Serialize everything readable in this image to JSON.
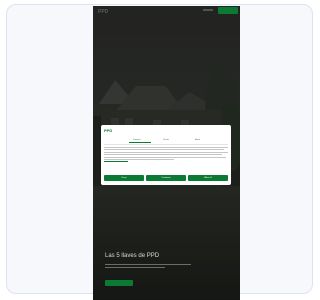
{
  "header": {
    "logo": "PPD",
    "cta_label": ""
  },
  "cookie_dialog": {
    "logo": "PPD",
    "tabs": [
      "Consent",
      "Details",
      "About"
    ],
    "active_tab": 0,
    "body_text": "",
    "buttons": [
      "Deny",
      "Customize",
      "Allow all"
    ]
  },
  "hero": {
    "title": "Las 5 llaves de PPD",
    "cta_label": ""
  },
  "colors": {
    "brand_green": "#0b7a34",
    "dialog_bg": "#ffffff",
    "page_bg": "#f6f8fc"
  }
}
